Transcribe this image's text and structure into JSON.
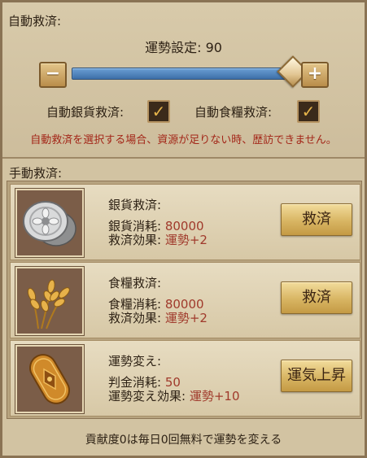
{
  "auto_rescue": {
    "title": "自動救済:",
    "luck_setting_label": "運勢設定:",
    "luck_setting_value": 90,
    "luck_value_text": "90",
    "minus_label": "−",
    "plus_label": "+",
    "silver_checkbox_label": "自動銀貨救済:",
    "silver_checked": true,
    "food_checkbox_label": "自動食糧救済:",
    "food_checked": true,
    "check_glyph": "✓",
    "warning": "自動救済を選択する場合、資源が足りない時、歴訪できません。"
  },
  "manual_rescue": {
    "title": "手動救済:",
    "rows": [
      {
        "icon": "silver-coin-icon",
        "title": "銀貨救済:",
        "cost_label": "銀貨消耗:",
        "cost_value": "80000",
        "effect_label": "救済効果:",
        "effect_value": "運勢+2",
        "button": "救済"
      },
      {
        "icon": "wheat-icon",
        "title": "食糧救済:",
        "cost_label": "食糧消耗:",
        "cost_value": "80000",
        "effect_label": "救済効果:",
        "effect_value": "運勢+2",
        "button": "救済"
      },
      {
        "icon": "gold-koban-icon",
        "title": "運勢変え:",
        "cost_label": "判金消耗:",
        "cost_value": "50",
        "effect_label": "運勢変え効果:",
        "effect_value": "運勢+10",
        "button": "運気上昇"
      }
    ]
  },
  "footer": "貢献度0は毎日0回無料で運勢を変える",
  "colors": {
    "warning": "#a32618",
    "value": "#a03a2c",
    "slider": "#4a7fbd",
    "button": "#d8b563"
  }
}
